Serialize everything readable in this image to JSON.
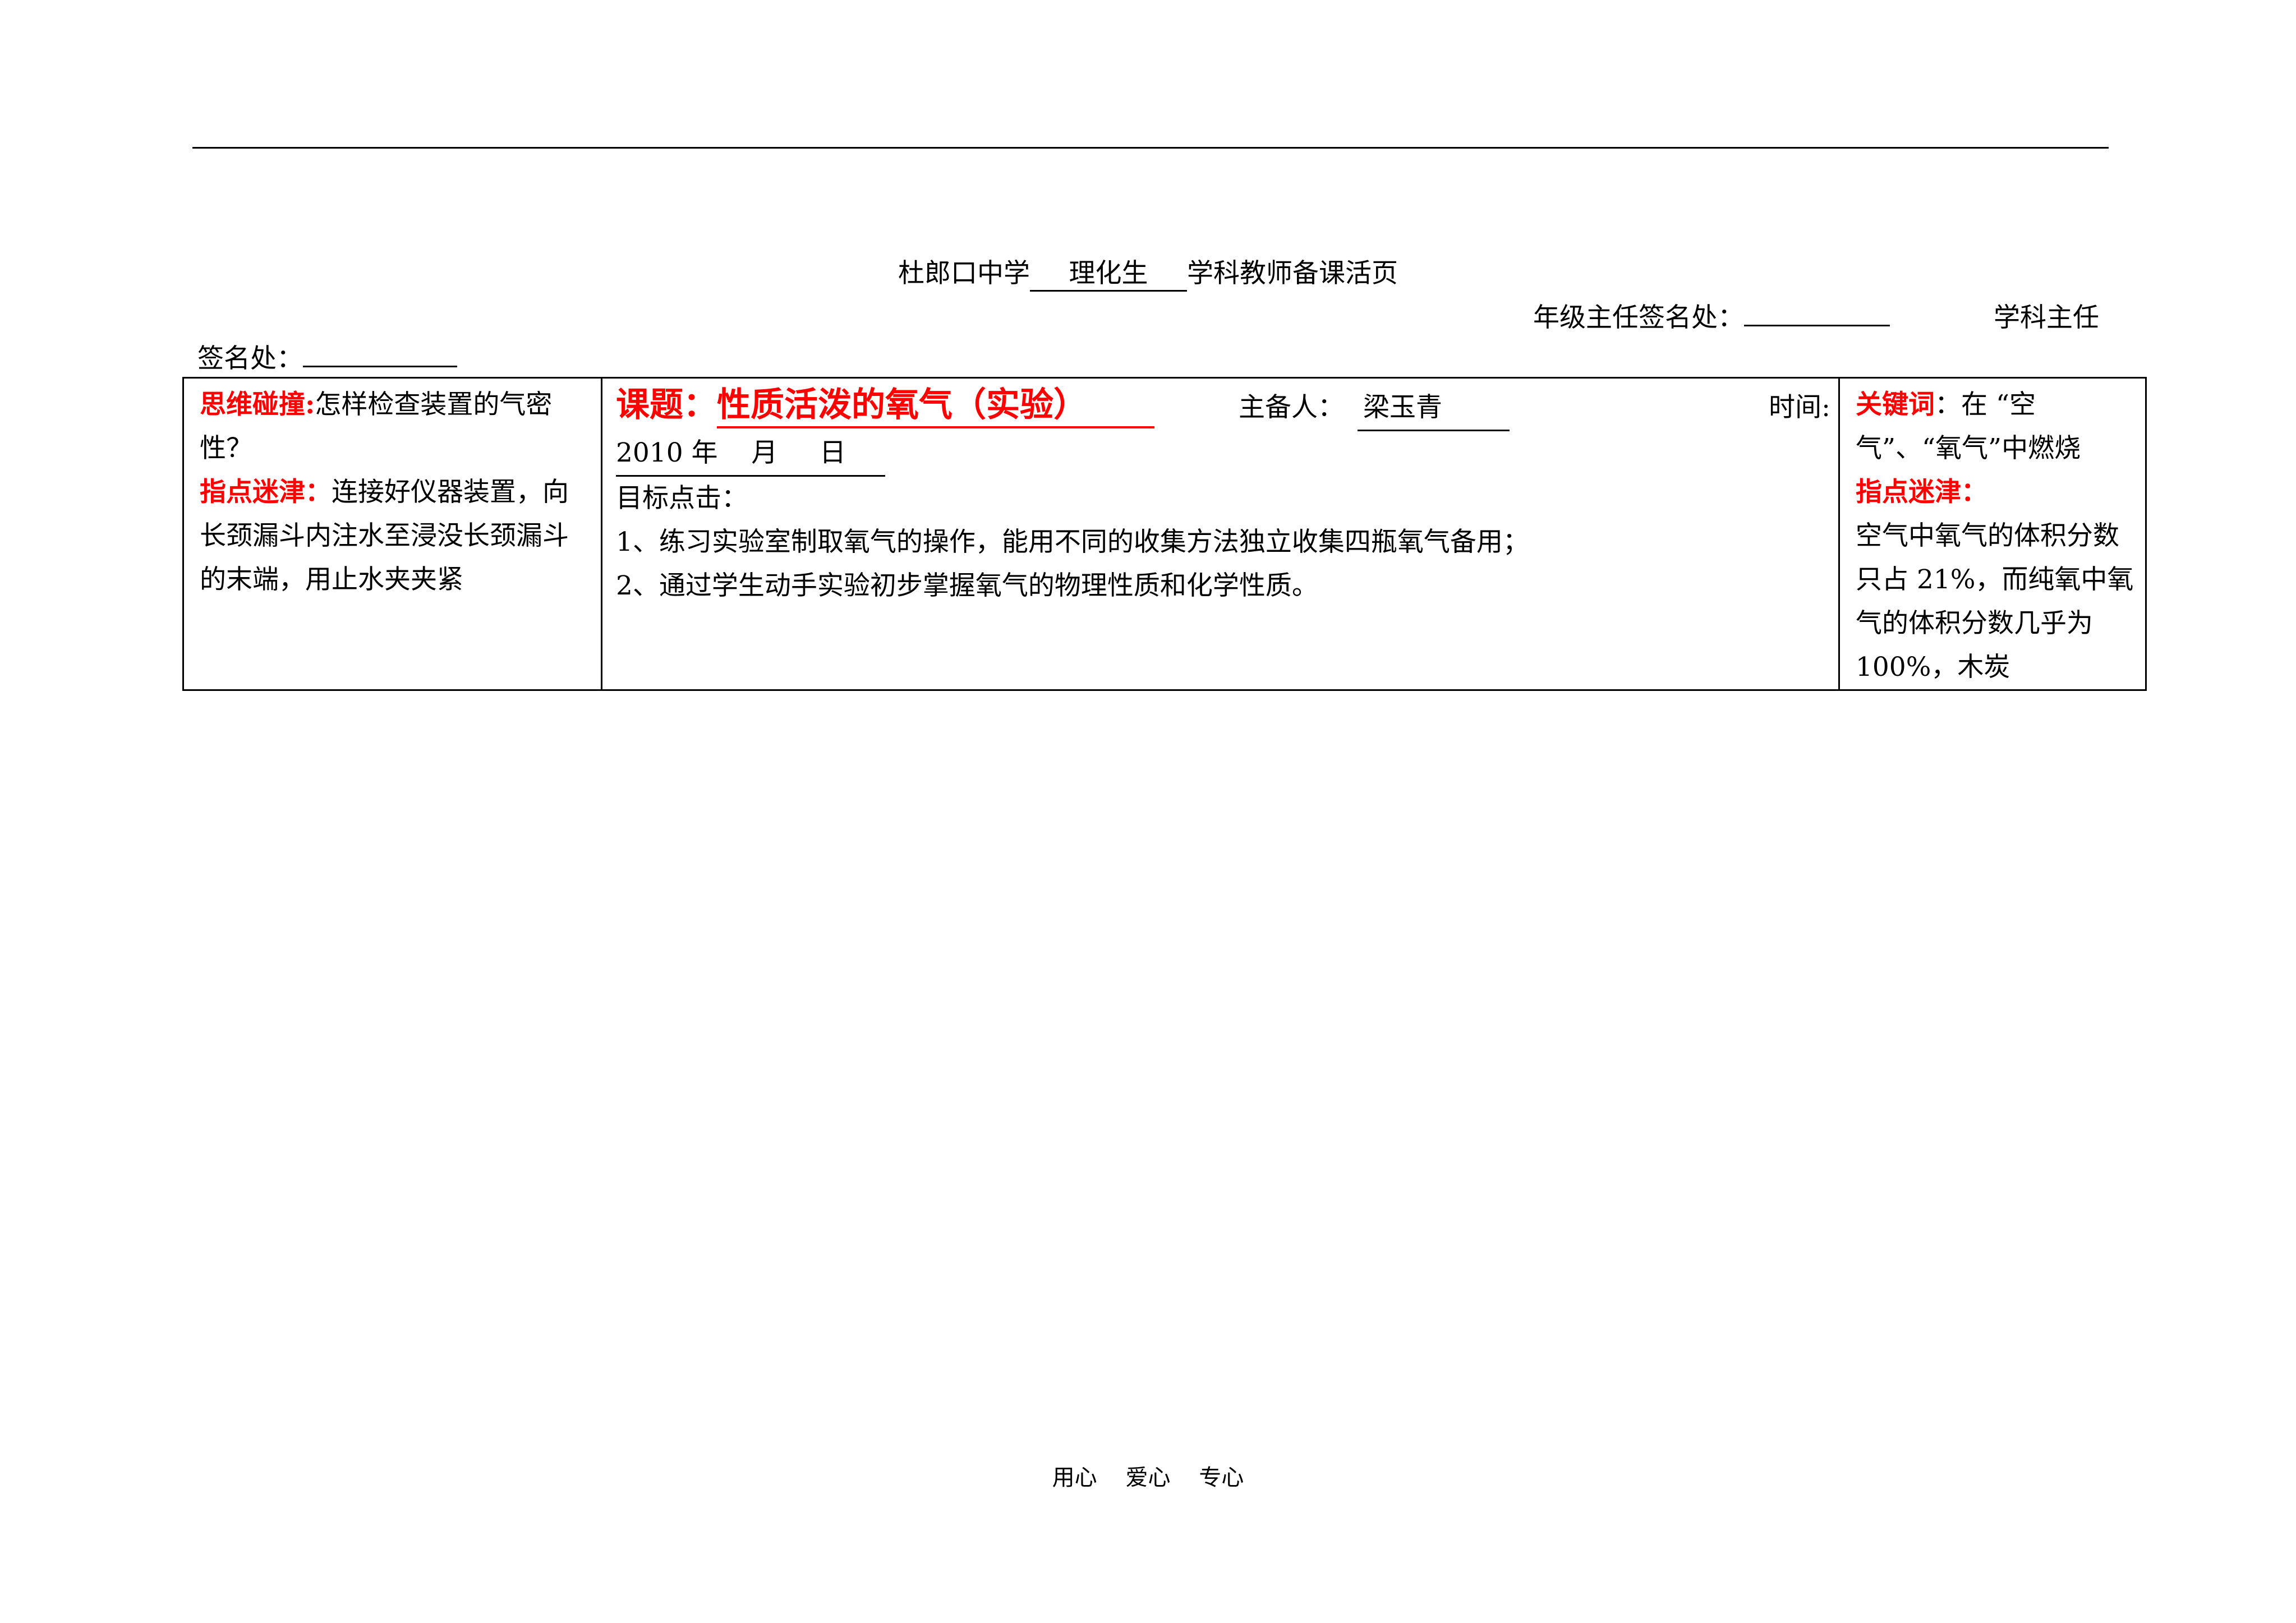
{
  "title": {
    "school": "杜郎口中学",
    "subject": "理化生",
    "suffix": "学科教师备课活页"
  },
  "signatures": {
    "grade_head_label": "年级主任签名处：",
    "subject_head_label": "学科主任",
    "sign_place_label": "签名处："
  },
  "left_cell": {
    "label1": "思维碰撞:",
    "text1": "怎样检查装置的气密性？",
    "label2": "指点迷津：",
    "text2": "连接好仪器装置，向长颈漏斗内注水至浸没长颈漏斗的末端，用止水夹夹紧"
  },
  "middle_cell": {
    "topic_label": "课题：",
    "topic_value": "性质活泼的氧气（实验）",
    "preparer_label": "主备人：",
    "preparer_value": "梁玉青",
    "time_label": "时间:",
    "date": "2010 年    月     日",
    "goals_label": "目标点击：",
    "goal1": "1、练习实验室制取氧气的操作，能用不同的收集方法独立收集四瓶氧气备用；",
    "goal2": "2、通过学生动手实验初步掌握氧气的物理性质和化学性质。"
  },
  "right_cell": {
    "keywords_label": "关键词",
    "keywords_text": "：在 “空气”、“氧气”中燃烧",
    "hint_label": "指点迷津：",
    "hint_text": "空气中氧气的体积分数只占 21%，而纯氧中氧气的体积分数几乎为 100%，木炭"
  },
  "footer": "用心    爱心    专心"
}
